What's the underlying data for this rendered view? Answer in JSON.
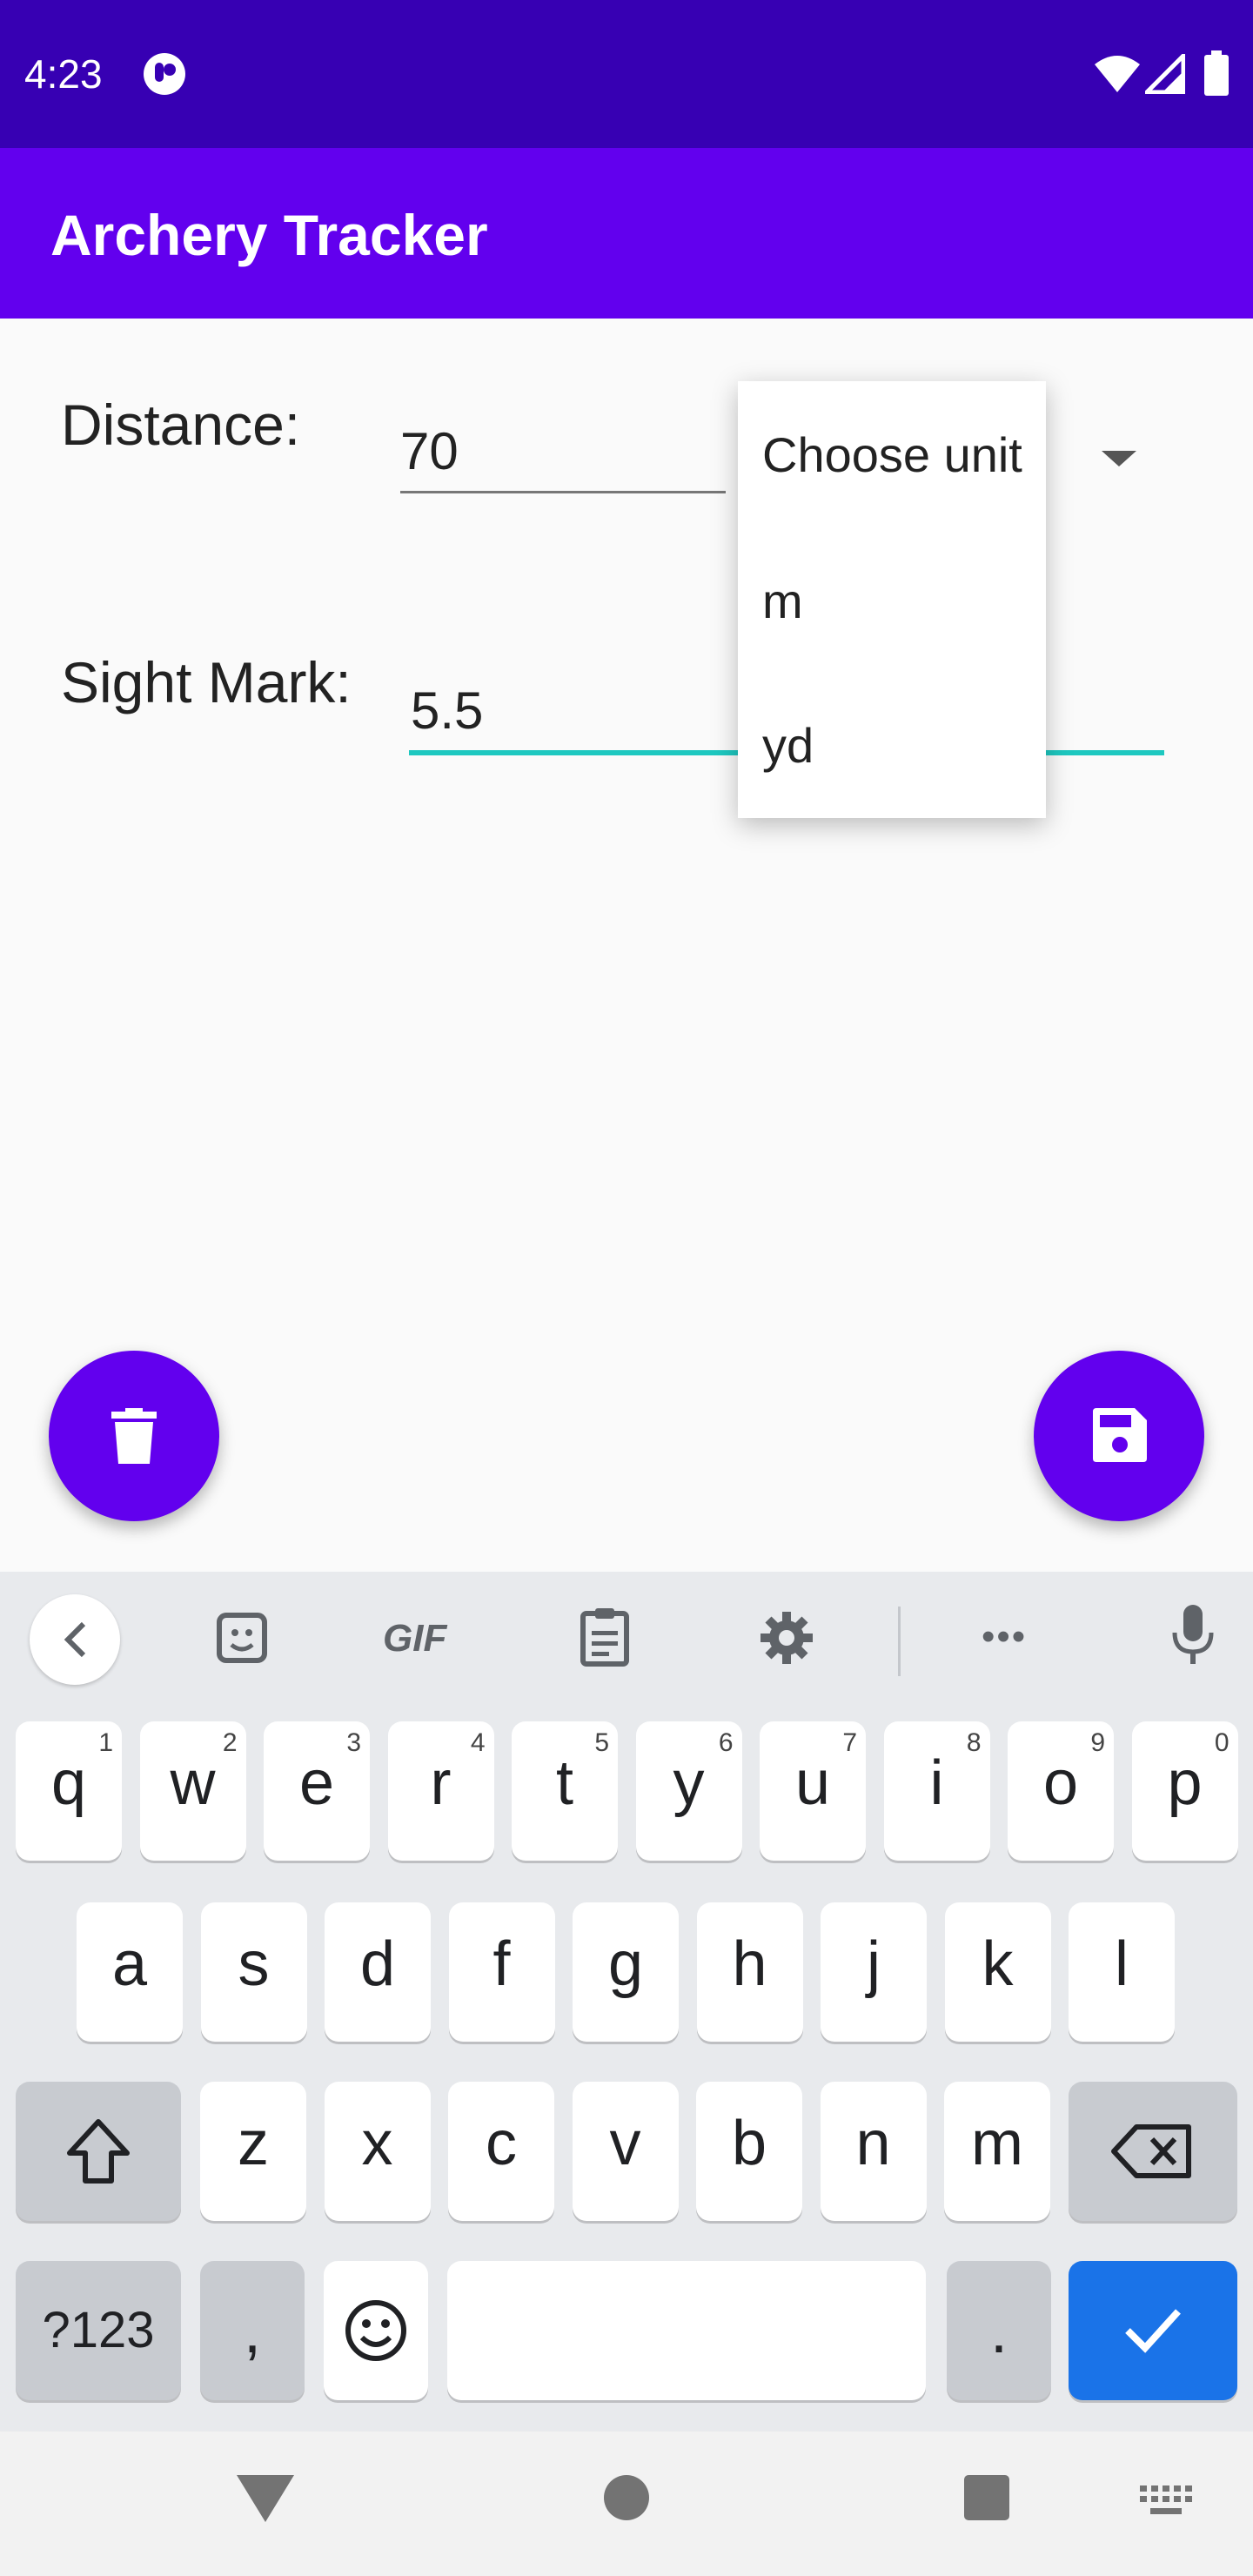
{
  "status_bar": {
    "time": "4:23"
  },
  "app": {
    "title": "Archery Tracker"
  },
  "form": {
    "distance_label": "Distance:",
    "distance_value": "70",
    "sight_label": "Sight Mark:",
    "sight_value": "5.5"
  },
  "unit_menu": {
    "items": [
      "Choose unit",
      "m",
      "yd"
    ]
  },
  "keyboard": {
    "row1": [
      {
        "key": "q",
        "sup": "1"
      },
      {
        "key": "w",
        "sup": "2"
      },
      {
        "key": "e",
        "sup": "3"
      },
      {
        "key": "r",
        "sup": "4"
      },
      {
        "key": "t",
        "sup": "5"
      },
      {
        "key": "y",
        "sup": "6"
      },
      {
        "key": "u",
        "sup": "7"
      },
      {
        "key": "i",
        "sup": "8"
      },
      {
        "key": "o",
        "sup": "9"
      },
      {
        "key": "p",
        "sup": "0"
      }
    ],
    "row2": [
      "a",
      "s",
      "d",
      "f",
      "g",
      "h",
      "j",
      "k",
      "l"
    ],
    "row3": [
      "z",
      "x",
      "c",
      "v",
      "b",
      "n",
      "m"
    ],
    "symbols_label": "?123",
    "comma": ",",
    "period": ".",
    "gif_label": "GIF",
    "more_label": "•••"
  },
  "colors": {
    "primary": "#6200ee",
    "primary_dark": "#3700b3",
    "accent": "#1ec8c0",
    "enter_key": "#1a73e8"
  },
  "icons": [
    "wifi-icon",
    "signal-icon",
    "battery-icon",
    "delete-icon",
    "save-icon",
    "back-icon",
    "sticker-icon",
    "clipboard-icon",
    "settings-icon",
    "mic-icon",
    "shift-icon",
    "backspace-icon",
    "emoji-icon",
    "check-icon"
  ]
}
